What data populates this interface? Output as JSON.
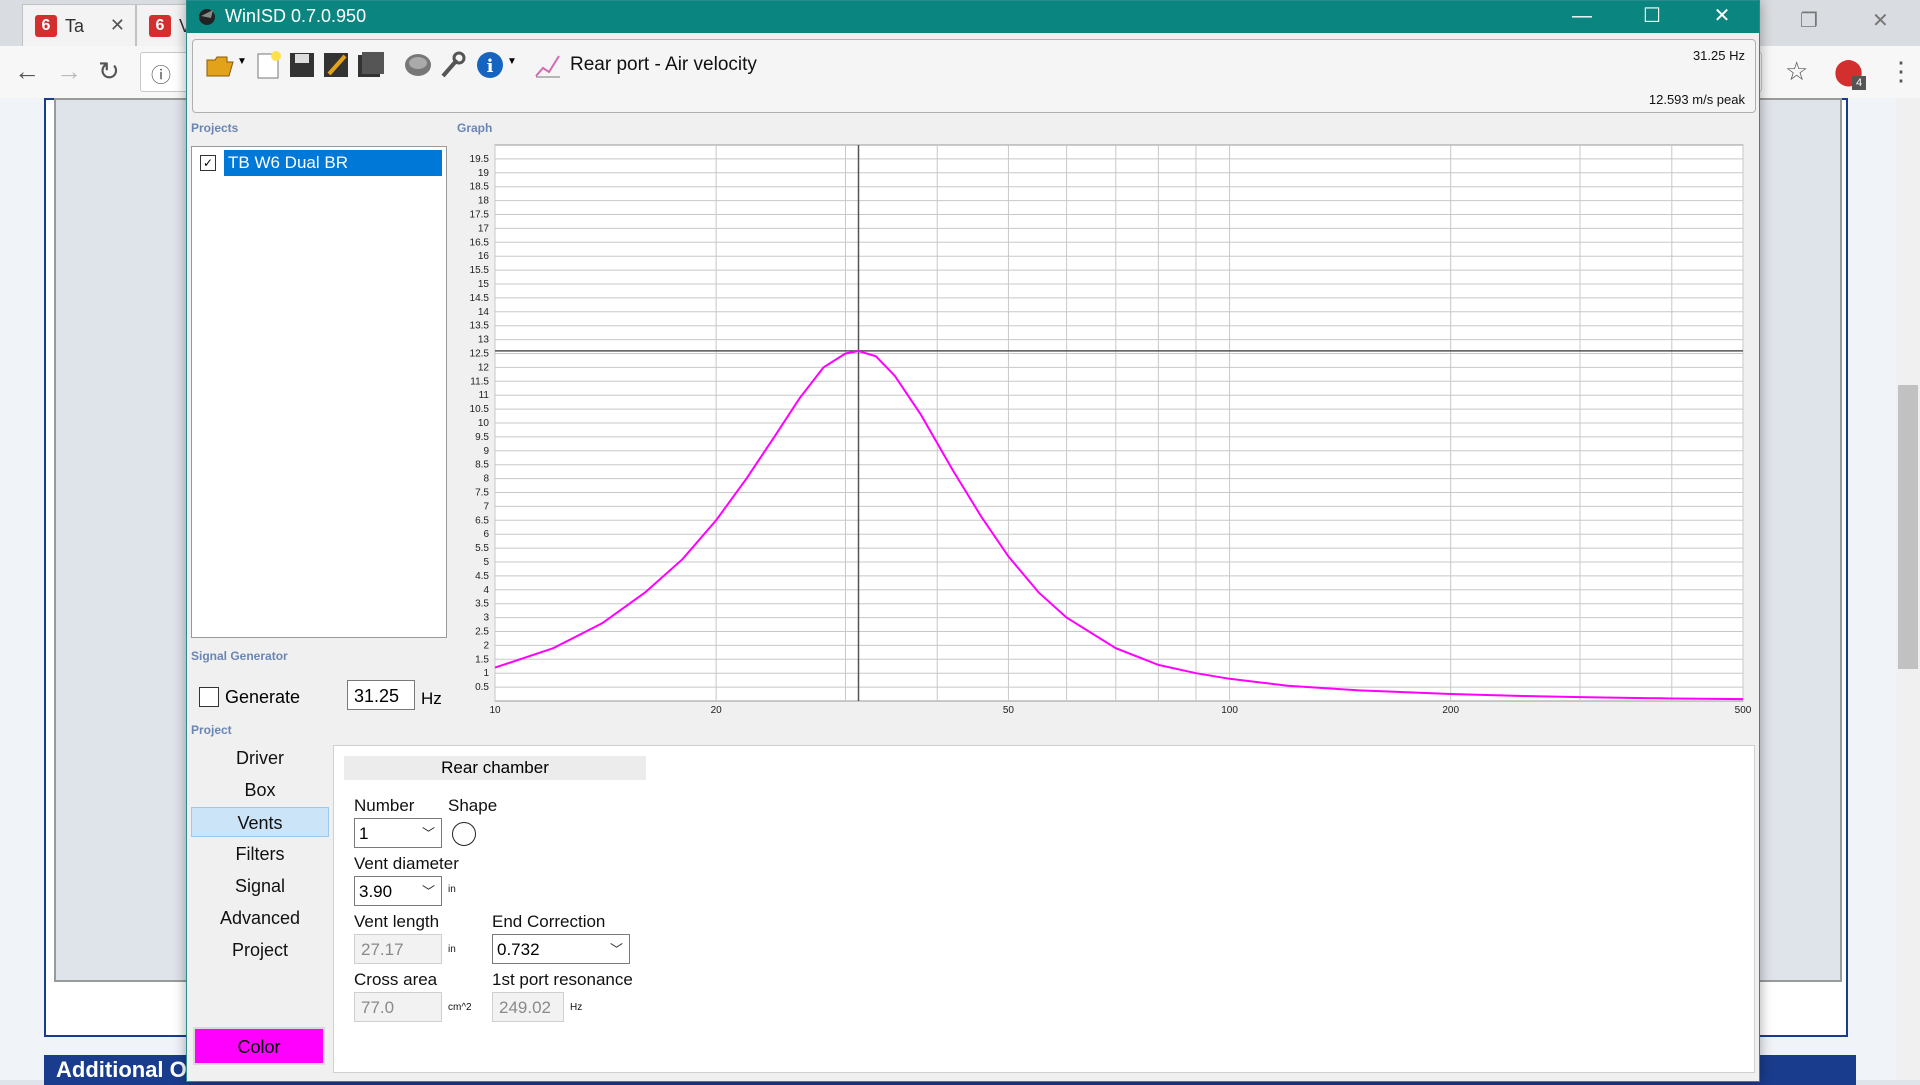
{
  "browser": {
    "tabs": [
      {
        "title": "Ta"
      },
      {
        "title": "V"
      }
    ],
    "footer_text": "Additional Options",
    "badge_count": "4"
  },
  "window": {
    "title": "WinISD 0.7.0.950",
    "colors": {
      "titlebar": "#0b8580",
      "curve": "#ff00ff",
      "selection": "#0078d7"
    }
  },
  "toolbar": {
    "graph_label": "Rear port - Air velocity",
    "cursor_freq": "31.25 Hz",
    "peak_value": "12.593 m/s peak",
    "icons": [
      "open-folder-icon",
      "new-project-icon",
      "save-icon",
      "save-as-icon",
      "save-all-icon",
      "driver-editor-icon",
      "tools-wrench-icon",
      "info-icon",
      "graph-icon"
    ]
  },
  "sections": {
    "projects": "Projects",
    "graph": "Graph",
    "signal_generator": "Signal Generator",
    "project": "Project"
  },
  "projects": [
    {
      "name": "TB W6 Dual BR",
      "checked": true
    }
  ],
  "signal_generator": {
    "checkbox_label": "Generate",
    "frequency": "31.25",
    "unit": "Hz",
    "checked": false
  },
  "nav": {
    "items": [
      {
        "label": "Driver",
        "active": false
      },
      {
        "label": "Box",
        "active": false
      },
      {
        "label": "Vents",
        "active": true
      },
      {
        "label": "Filters",
        "active": false
      },
      {
        "label": "Signal",
        "active": false
      },
      {
        "label": "Advanced",
        "active": false
      },
      {
        "label": "Project",
        "active": false
      }
    ],
    "color_button": "Color"
  },
  "vents": {
    "section_title": "Rear chamber",
    "number_label": "Number",
    "number_value": "1",
    "shape_label": "Shape",
    "diameter_label": "Vent diameter",
    "diameter_value": "3.90",
    "diameter_unit": "in",
    "length_label": "Vent length",
    "length_value": "27.17",
    "length_unit": "in",
    "end_correction_label": "End Correction",
    "end_correction_value": "0.732",
    "cross_area_label": "Cross area",
    "cross_area_value": "77.0",
    "cross_area_unit": "cm^2",
    "port_resonance_label": "1st port resonance",
    "port_resonance_value": "249.02",
    "port_resonance_unit": "Hz"
  },
  "chart_data": {
    "type": "line",
    "xscale": "log",
    "xlim": [
      10,
      500
    ],
    "ylim": [
      0,
      20
    ],
    "x_tick_labels": [
      "10",
      "20",
      "50",
      "100",
      "200",
      "500"
    ],
    "y_tick_labels": [
      "0.5",
      "1",
      "1.5",
      "2",
      "2.5",
      "3",
      "3.5",
      "4",
      "4.5",
      "5",
      "5.5",
      "6",
      "6.5",
      "7",
      "7.5",
      "8",
      "8.5",
      "9",
      "9.5",
      "10",
      "10.5",
      "11",
      "11.5",
      "12",
      "12.5",
      "13",
      "13.5",
      "14",
      "14.5",
      "15",
      "15.5",
      "16",
      "16.5",
      "17",
      "17.5",
      "18",
      "18.5",
      "19",
      "19.5"
    ],
    "cursor": {
      "x": 31.25,
      "y": 12.593
    },
    "series": [
      {
        "color": "#ff00ff",
        "x": [
          10,
          12,
          14,
          16,
          18,
          20,
          22,
          24,
          26,
          28,
          30,
          31.25,
          33,
          35,
          38,
          42,
          46,
          50,
          55,
          60,
          70,
          80,
          90,
          100,
          120,
          150,
          200,
          250,
          300,
          400,
          500
        ],
        "y": [
          1.2,
          1.9,
          2.8,
          3.9,
          5.1,
          6.5,
          8.0,
          9.5,
          10.9,
          12.0,
          12.5,
          12.59,
          12.4,
          11.7,
          10.3,
          8.3,
          6.6,
          5.2,
          3.9,
          3.0,
          1.9,
          1.3,
          1.0,
          0.8,
          0.55,
          0.38,
          0.25,
          0.18,
          0.14,
          0.09,
          0.07
        ]
      }
    ],
    "grid": true
  }
}
